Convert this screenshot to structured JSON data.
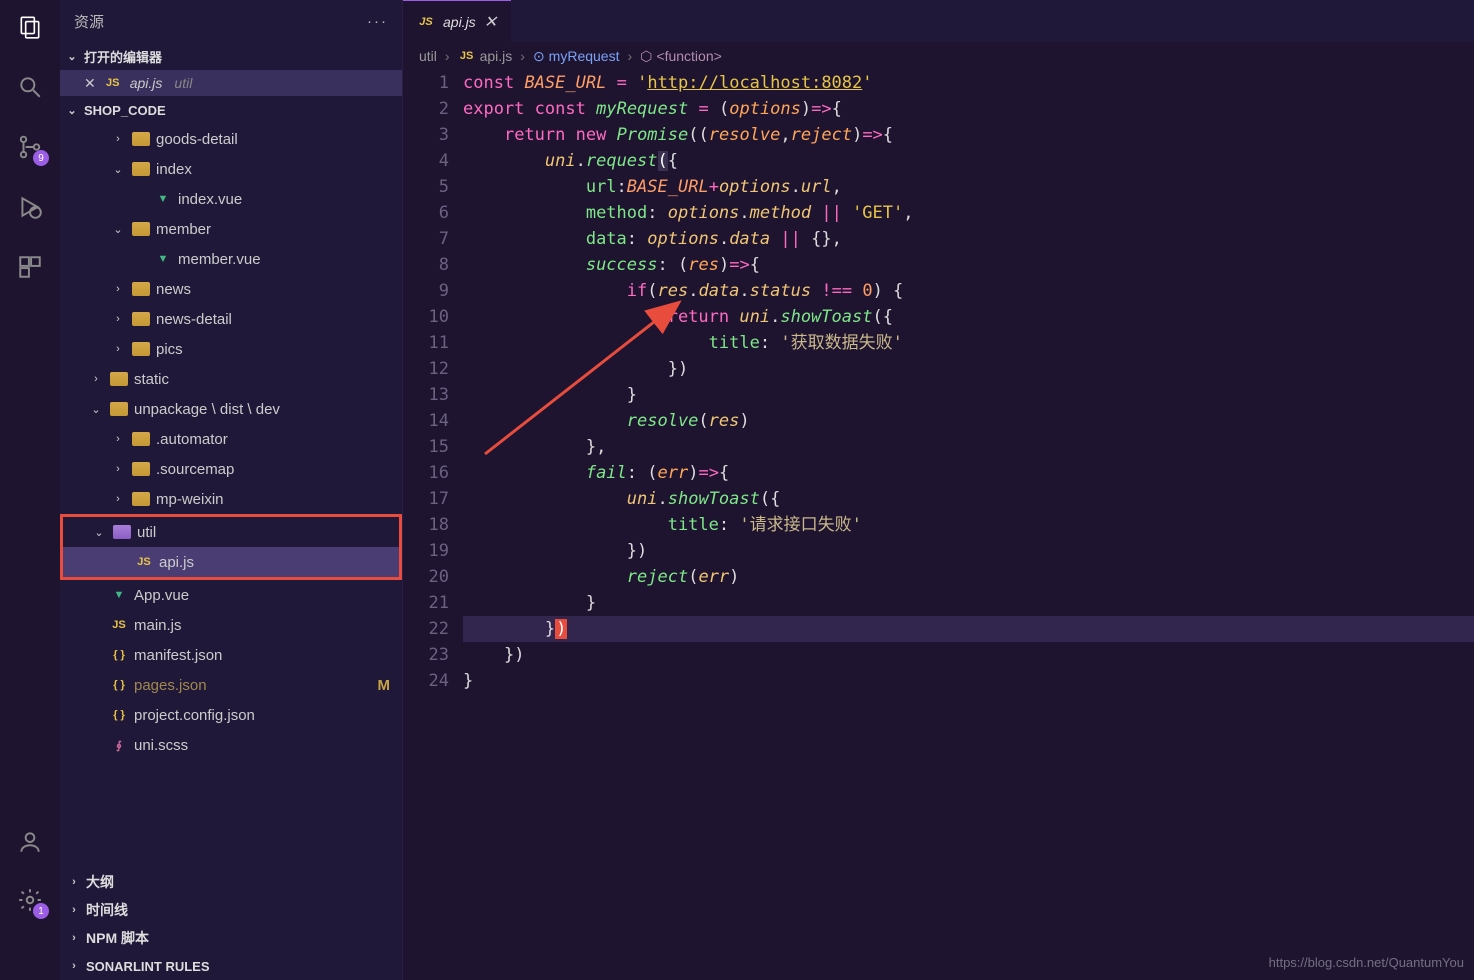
{
  "sidebar": {
    "title": "资源",
    "open_editors_label": "打开的编辑器",
    "open_file": {
      "name": "api.js",
      "dir": "util"
    },
    "workspace": "SHOP_CODE",
    "tree": [
      {
        "indent": 2,
        "chev": "›",
        "icon": "folder",
        "label": "goods-detail"
      },
      {
        "indent": 2,
        "chev": "⌄",
        "icon": "folder-open",
        "label": "index"
      },
      {
        "indent": 3,
        "chev": "",
        "icon": "vue",
        "label": "index.vue"
      },
      {
        "indent": 2,
        "chev": "⌄",
        "icon": "folder-open",
        "label": "member"
      },
      {
        "indent": 3,
        "chev": "",
        "icon": "vue",
        "label": "member.vue"
      },
      {
        "indent": 2,
        "chev": "›",
        "icon": "folder",
        "label": "news"
      },
      {
        "indent": 2,
        "chev": "›",
        "icon": "folder",
        "label": "news-detail"
      },
      {
        "indent": 2,
        "chev": "›",
        "icon": "folder",
        "label": "pics"
      },
      {
        "indent": 1,
        "chev": "›",
        "icon": "folder",
        "label": "static"
      },
      {
        "indent": 1,
        "chev": "⌄",
        "icon": "folder-open",
        "label": "unpackage \\ dist \\ dev"
      },
      {
        "indent": 2,
        "chev": "›",
        "icon": "folder",
        "label": ".automator"
      },
      {
        "indent": 2,
        "chev": "›",
        "icon": "folder",
        "label": ".sourcemap"
      },
      {
        "indent": 2,
        "chev": "›",
        "icon": "folder",
        "label": "mp-weixin"
      },
      {
        "indent": 1,
        "chev": "⌄",
        "icon": "folder-purple",
        "label": "util",
        "hl": true
      },
      {
        "indent": 2,
        "chev": "",
        "icon": "js",
        "label": "api.js",
        "selected": true
      },
      {
        "indent": 1,
        "chev": "",
        "icon": "vue",
        "label": "App.vue"
      },
      {
        "indent": 1,
        "chev": "",
        "icon": "js",
        "label": "main.js"
      },
      {
        "indent": 1,
        "chev": "",
        "icon": "json",
        "label": "manifest.json"
      },
      {
        "indent": 1,
        "chev": "",
        "icon": "json",
        "label": "pages.json",
        "git": "M",
        "muted": true
      },
      {
        "indent": 1,
        "chev": "",
        "icon": "json",
        "label": "project.config.json"
      },
      {
        "indent": 1,
        "chev": "",
        "icon": "scss",
        "label": "uni.scss"
      }
    ],
    "outline": "大纲",
    "timeline": "时间线",
    "npm": "NPM 脚本",
    "sonar": "SONARLINT RULES"
  },
  "activity": {
    "scm_badge": "9",
    "settings_badge": "1"
  },
  "tab": {
    "name": "api.js"
  },
  "breadcrumb": {
    "p1": "util",
    "p2": "api.js",
    "p3": "myRequest",
    "p4": "<function>"
  },
  "code": {
    "lines": 24,
    "url": "http://localhost:8082",
    "toast1": "获取数据失败",
    "toast2": "请求接口失败"
  },
  "watermark": "https://blog.csdn.net/QuantumYou"
}
